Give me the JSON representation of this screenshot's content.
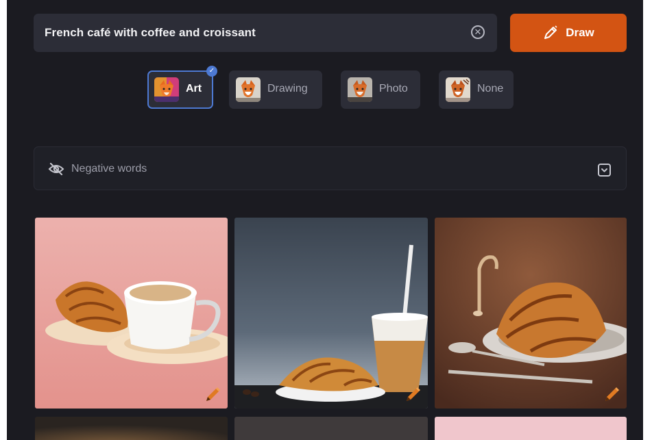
{
  "prompt": {
    "value": "French café with coffee and croissant",
    "clear_icon": "close-circle-icon"
  },
  "draw_button": {
    "label": "Draw",
    "icon": "pencil-icon",
    "color": "#d35413"
  },
  "styles": [
    {
      "label": "Art",
      "selected": true,
      "thumb_icon": "fox-art-thumbnail"
    },
    {
      "label": "Drawing",
      "selected": false,
      "thumb_icon": "fox-drawing-thumbnail"
    },
    {
      "label": "Photo",
      "selected": false,
      "thumb_icon": "fox-photo-thumbnail"
    },
    {
      "label": "None",
      "selected": false,
      "thumb_icon": "fox-none-thumbnail"
    }
  ],
  "negative_words": {
    "label": "Negative words",
    "icon": "eye-off-icon",
    "toggle_icon": "chevron-down-box-icon"
  },
  "results": [
    {
      "image": "croissant-and-coffee-cup-on-pink",
      "action_icon": "edit-pencil-icon"
    },
    {
      "image": "croissant-and-iced-coffee-on-grey",
      "action_icon": "edit-pencil-icon"
    },
    {
      "image": "croissant-on-plate-on-brown",
      "action_icon": "edit-pencil-icon"
    },
    {
      "image": "partial-image-dark-bokeh"
    },
    {
      "image": "partial-image-dark-grey"
    },
    {
      "image": "partial-image-pink"
    }
  ],
  "colors": {
    "background": "#1b1b21",
    "surface": "#2c2d37",
    "accent": "#d35413",
    "selection": "#4d79d2"
  }
}
